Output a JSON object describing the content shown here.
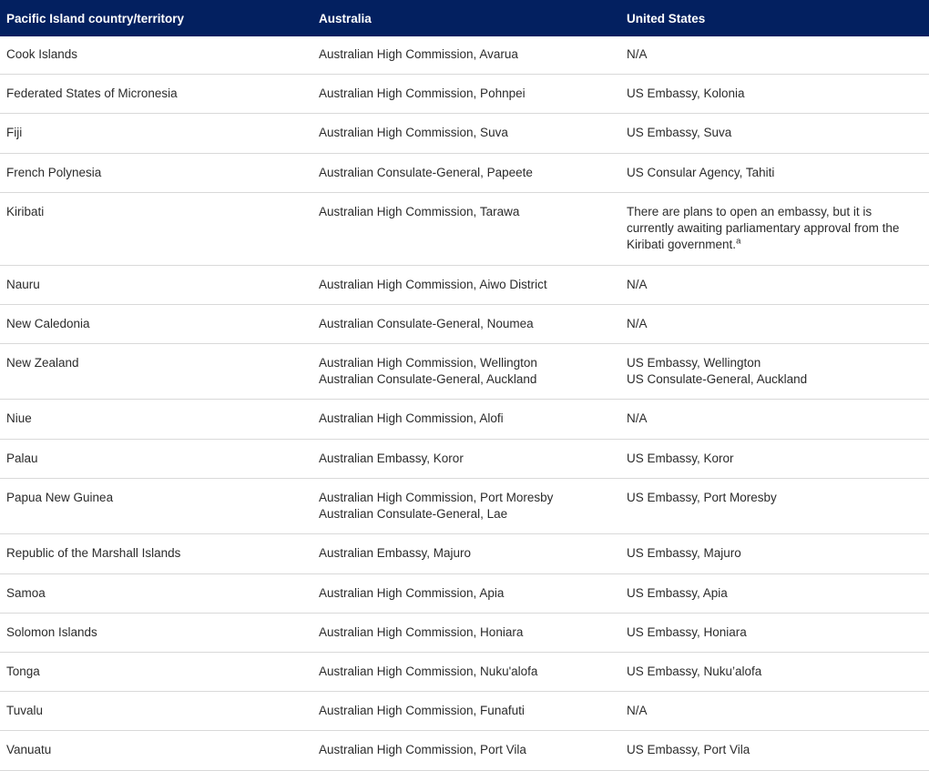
{
  "table": {
    "header": {
      "columns": [
        {
          "label": "Pacific Island country/territory"
        },
        {
          "label": "Australia"
        },
        {
          "label": "United States"
        }
      ],
      "background_color": "#032060",
      "text_color": "#ffffff"
    },
    "row_divider_color": "#d9d9d9",
    "rows": [
      {
        "country": "Cook Islands",
        "australia": [
          "Australian High Commission, Avarua"
        ],
        "united_states": [
          "N/A"
        ]
      },
      {
        "country": "Federated States of Micronesia",
        "australia": [
          "Australian High Commission, Pohnpei"
        ],
        "united_states": [
          "US Embassy, Kolonia"
        ]
      },
      {
        "country": "Fiji",
        "australia": [
          "Australian High Commission, Suva"
        ],
        "united_states": [
          "US Embassy, Suva"
        ]
      },
      {
        "country": "French Polynesia",
        "australia": [
          "Australian Consulate-General, Papeete"
        ],
        "united_states": [
          "US Consular Agency, Tahiti"
        ]
      },
      {
        "country": "Kiribati",
        "australia": [
          "Australian High Commission, Tarawa"
        ],
        "united_states": [
          "There are plans to open an embassy, but it is currently awaiting parliamentary approval from the Kiribati government."
        ],
        "united_states_footnote": "a"
      },
      {
        "country": "Nauru",
        "australia": [
          "Australian High Commission, Aiwo District"
        ],
        "united_states": [
          "N/A"
        ]
      },
      {
        "country": "New Caledonia",
        "australia": [
          "Australian Consulate-General, Noumea"
        ],
        "united_states": [
          "N/A"
        ]
      },
      {
        "country": "New Zealand",
        "australia": [
          "Australian High Commission, Wellington",
          "Australian Consulate-General, Auckland"
        ],
        "united_states": [
          "US Embassy, Wellington",
          "US Consulate-General, Auckland"
        ]
      },
      {
        "country": "Niue",
        "australia": [
          "Australian High Commission, Alofi"
        ],
        "united_states": [
          "N/A"
        ]
      },
      {
        "country": "Palau",
        "australia": [
          "Australian Embassy, Koror"
        ],
        "united_states": [
          "US Embassy, Koror"
        ]
      },
      {
        "country": "Papua New Guinea",
        "australia": [
          "Australian High Commission, Port Moresby",
          "Australian Consulate-General, Lae"
        ],
        "united_states": [
          "US Embassy, Port Moresby"
        ]
      },
      {
        "country": "Republic of the Marshall Islands",
        "australia": [
          "Australian Embassy, Majuro"
        ],
        "united_states": [
          "US Embassy, Majuro"
        ]
      },
      {
        "country": "Samoa",
        "australia": [
          "Australian High Commission, Apia"
        ],
        "united_states": [
          "US Embassy, Apia"
        ]
      },
      {
        "country": "Solomon Islands",
        "australia": [
          "Australian High Commission, Honiara"
        ],
        "united_states": [
          "US Embassy, Honiara"
        ]
      },
      {
        "country": "Tonga",
        "australia": [
          "Australian High Commission, Nuku'alofa"
        ],
        "united_states": [
          "US Embassy, Nuku’alofa"
        ]
      },
      {
        "country": "Tuvalu",
        "australia": [
          "Australian High Commission, Funafuti"
        ],
        "united_states": [
          "N/A"
        ]
      },
      {
        "country": "Vanuatu",
        "australia": [
          "Australian High Commission, Port Vila"
        ],
        "united_states": [
          "US Embassy, Port Vila"
        ]
      }
    ]
  }
}
